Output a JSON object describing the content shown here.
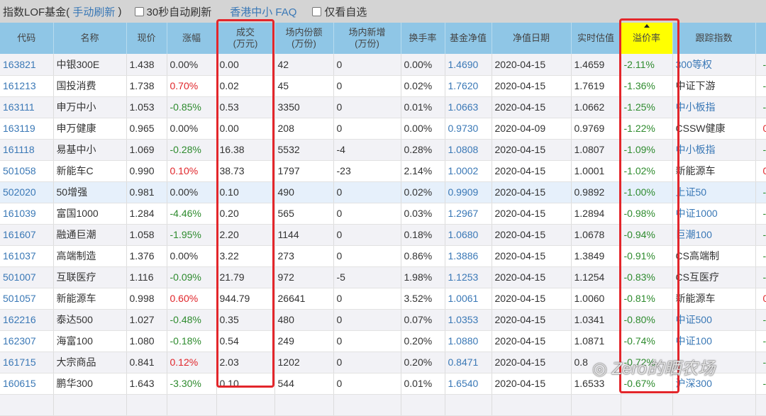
{
  "topbar": {
    "title": "指数LOF基金(",
    "refresh": "手动刷新",
    "close_paren": ")",
    "auto_refresh": "30秒自动刷新",
    "faq": "香港中小 FAQ",
    "only_fav": "仅看自选"
  },
  "headers": [
    "代码",
    "名称",
    "现价",
    "涨幅",
    "成交\n(万元)",
    "场内份额\n(万份)",
    "场内新增\n(万份)",
    "换手率",
    "基金净值",
    "净值日期",
    "实时估值",
    "溢价率",
    "跟踪指数",
    ""
  ],
  "rows": [
    [
      "163821",
      "中银300E",
      "1.438",
      "0.00%",
      "0.00",
      "42",
      "0",
      "0.00%",
      "1.4690",
      "2020-04-15",
      "1.4659",
      "-2.11%",
      "300等权",
      "-"
    ],
    [
      "161213",
      "国投消费",
      "1.738",
      "0.70%",
      "0.02",
      "45",
      "0",
      "0.02%",
      "1.7620",
      "2020-04-15",
      "1.7619",
      "-1.36%",
      "中证下游",
      "-"
    ],
    [
      "163111",
      "申万中小",
      "1.053",
      "-0.85%",
      "0.53",
      "3350",
      "0",
      "0.01%",
      "1.0663",
      "2020-04-15",
      "1.0662",
      "-1.25%",
      "中小板指",
      "-"
    ],
    [
      "163119",
      "申万健康",
      "0.965",
      "0.00%",
      "0.00",
      "208",
      "0",
      "0.00%",
      "0.9730",
      "2020-04-09",
      "0.9769",
      "-1.22%",
      "CSSW健康",
      "0"
    ],
    [
      "161118",
      "易基中小",
      "1.069",
      "-0.28%",
      "16.38",
      "5532",
      "-4",
      "0.28%",
      "1.0808",
      "2020-04-15",
      "1.0807",
      "-1.09%",
      "中小板指",
      "-"
    ],
    [
      "501058",
      "新能车C",
      "0.990",
      "0.10%",
      "38.73",
      "1797",
      "-23",
      "2.14%",
      "1.0002",
      "2020-04-15",
      "1.0001",
      "-1.02%",
      "新能源车",
      "0"
    ],
    [
      "502020",
      "50增强",
      "0.981",
      "0.00%",
      "0.10",
      "490",
      "0",
      "0.02%",
      "0.9909",
      "2020-04-15",
      "0.9892",
      "-1.00%",
      "上证50",
      "-"
    ],
    [
      "161039",
      "富国1000",
      "1.284",
      "-4.46%",
      "0.20",
      "565",
      "0",
      "0.03%",
      "1.2967",
      "2020-04-15",
      "1.2894",
      "-0.98%",
      "中证1000",
      "-"
    ],
    [
      "161607",
      "融通巨潮",
      "1.058",
      "-1.95%",
      "2.20",
      "1144",
      "0",
      "0.18%",
      "1.0680",
      "2020-04-15",
      "1.0678",
      "-0.94%",
      "巨潮100",
      "-"
    ],
    [
      "161037",
      "高端制造",
      "1.376",
      "0.00%",
      "3.22",
      "273",
      "0",
      "0.86%",
      "1.3886",
      "2020-04-15",
      "1.3849",
      "-0.91%",
      "CS高端制",
      "-"
    ],
    [
      "501007",
      "互联医疗",
      "1.116",
      "-0.09%",
      "21.79",
      "972",
      "-5",
      "1.98%",
      "1.1253",
      "2020-04-15",
      "1.1254",
      "-0.83%",
      "CS互医疗",
      "-"
    ],
    [
      "501057",
      "新能源车",
      "0.998",
      "0.60%",
      "944.79",
      "26641",
      "0",
      "3.52%",
      "1.0061",
      "2020-04-15",
      "1.0060",
      "-0.81%",
      "新能源车",
      "0"
    ],
    [
      "162216",
      "泰达500",
      "1.027",
      "-0.48%",
      "0.35",
      "480",
      "0",
      "0.07%",
      "1.0353",
      "2020-04-15",
      "1.0341",
      "-0.80%",
      "中证500",
      "-"
    ],
    [
      "162307",
      "海富100",
      "1.080",
      "-0.18%",
      "0.54",
      "249",
      "0",
      "0.20%",
      "1.0880",
      "2020-04-15",
      "1.0871",
      "-0.74%",
      "中证100",
      "-"
    ],
    [
      "161715",
      "大宗商品",
      "0.841",
      "0.12%",
      "2.03",
      "1202",
      "0",
      "0.20%",
      "0.8471",
      "2020-04-15",
      "0.8",
      "-0.72%",
      "",
      "-"
    ],
    [
      "160615",
      "鹏华300",
      "1.643",
      "-3.30%",
      "0.10",
      "544",
      "0",
      "0.01%",
      "1.6540",
      "2020-04-15",
      "1.6533",
      "-0.67%",
      "沪深300",
      "-"
    ]
  ],
  "index_link": [
    true,
    false,
    true,
    false,
    true,
    false,
    true,
    true,
    true,
    false,
    false,
    false,
    true,
    true,
    false,
    true
  ],
  "watermark": "Zero的晒农场"
}
